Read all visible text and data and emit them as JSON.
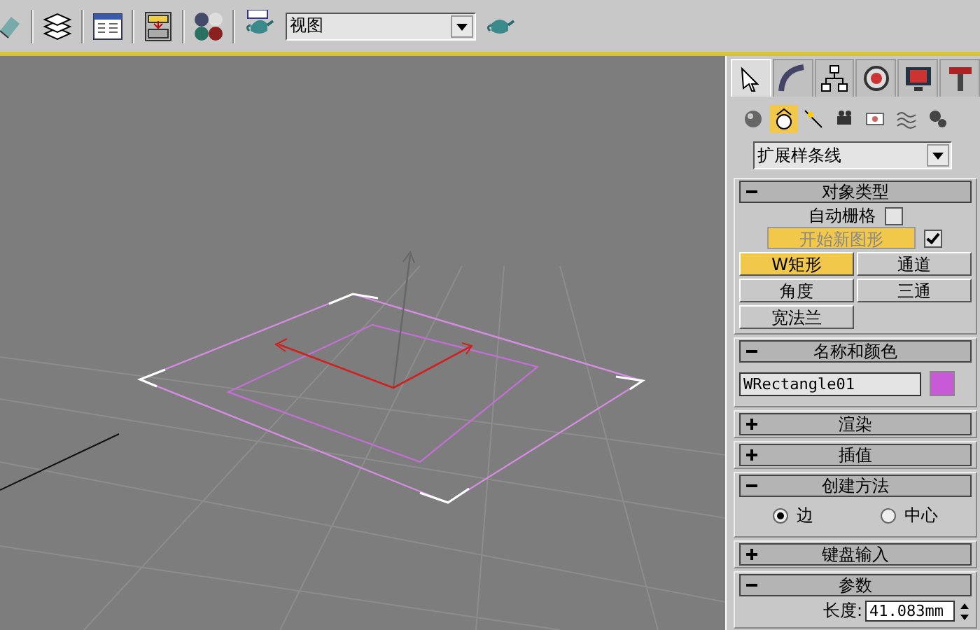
{
  "toolbar": {
    "view_dropdown": {
      "value": "视图"
    }
  },
  "command_panel": {
    "tabs": [
      {
        "selected": true
      },
      {
        "selected": false
      },
      {
        "selected": false
      },
      {
        "selected": false
      },
      {
        "selected": false
      },
      {
        "selected": false
      }
    ],
    "categories": [
      {
        "selected": false
      },
      {
        "selected": true
      },
      {
        "selected": false
      },
      {
        "selected": false
      },
      {
        "selected": false
      },
      {
        "selected": false
      },
      {
        "selected": false
      }
    ],
    "type_dropdown": {
      "value": "扩展样条线"
    },
    "rollouts": [
      {
        "title": "对象类型",
        "expanded": true,
        "auto_grid": {
          "label": "自动栅格",
          "checked": false
        },
        "start_new_shape": {
          "label": "开始新图形",
          "checked": true
        },
        "buttons": [
          {
            "label": "W矩形",
            "selected": true
          },
          {
            "label": "通道",
            "selected": false
          },
          {
            "label": "角度",
            "selected": false
          },
          {
            "label": "三通",
            "selected": false
          },
          {
            "label": "宽法兰",
            "selected": false
          }
        ]
      },
      {
        "title": "名称和颜色",
        "expanded": true,
        "name_field": {
          "value": "WRectangle01",
          "color": "#c85ad8"
        }
      },
      {
        "title": "渲染",
        "expanded": false
      },
      {
        "title": "插值",
        "expanded": false
      },
      {
        "title": "创建方法",
        "expanded": true,
        "radios": [
          {
            "label": "边",
            "selected": true
          },
          {
            "label": "中心",
            "selected": false
          }
        ]
      },
      {
        "title": "键盘输入",
        "expanded": false
      },
      {
        "title": "参数",
        "expanded": true,
        "fields": [
          {
            "label": "长度:",
            "value": "41.083mm"
          }
        ]
      }
    ]
  }
}
